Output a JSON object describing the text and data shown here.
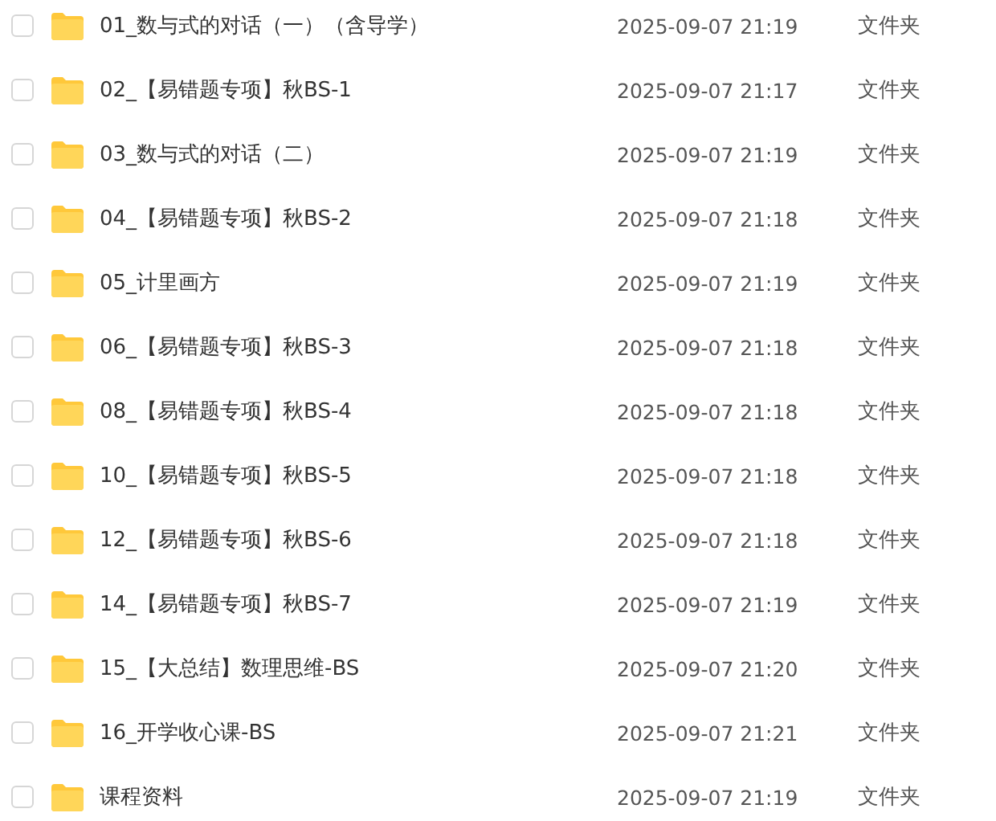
{
  "files": [
    {
      "name": "01_数与式的对话（一）（含导学）",
      "modified": "2025-09-07 21:19",
      "type": "文件夹",
      "checked": false
    },
    {
      "name": "02_【易错题专项】秋BS-1",
      "modified": "2025-09-07 21:17",
      "type": "文件夹",
      "checked": false
    },
    {
      "name": "03_数与式的对话（二）",
      "modified": "2025-09-07 21:19",
      "type": "文件夹",
      "checked": false
    },
    {
      "name": "04_【易错题专项】秋BS-2",
      "modified": "2025-09-07 21:18",
      "type": "文件夹",
      "checked": false
    },
    {
      "name": "05_计里画方",
      "modified": "2025-09-07 21:19",
      "type": "文件夹",
      "checked": false
    },
    {
      "name": "06_【易错题专项】秋BS-3",
      "modified": "2025-09-07 21:18",
      "type": "文件夹",
      "checked": false
    },
    {
      "name": "08_【易错题专项】秋BS-4",
      "modified": "2025-09-07 21:18",
      "type": "文件夹",
      "checked": false
    },
    {
      "name": "10_【易错题专项】秋BS-5",
      "modified": "2025-09-07 21:18",
      "type": "文件夹",
      "checked": false
    },
    {
      "name": "12_【易错题专项】秋BS-6",
      "modified": "2025-09-07 21:18",
      "type": "文件夹",
      "checked": false
    },
    {
      "name": "14_【易错题专项】秋BS-7",
      "modified": "2025-09-07 21:19",
      "type": "文件夹",
      "checked": false
    },
    {
      "name": "15_【大总结】数理思维-BS",
      "modified": "2025-09-07 21:20",
      "type": "文件夹",
      "checked": false
    },
    {
      "name": "16_开学收心课-BS",
      "modified": "2025-09-07 21:21",
      "type": "文件夹",
      "checked": false
    },
    {
      "name": "课程资料",
      "modified": "2025-09-07 21:19",
      "type": "文件夹",
      "checked": false
    }
  ]
}
